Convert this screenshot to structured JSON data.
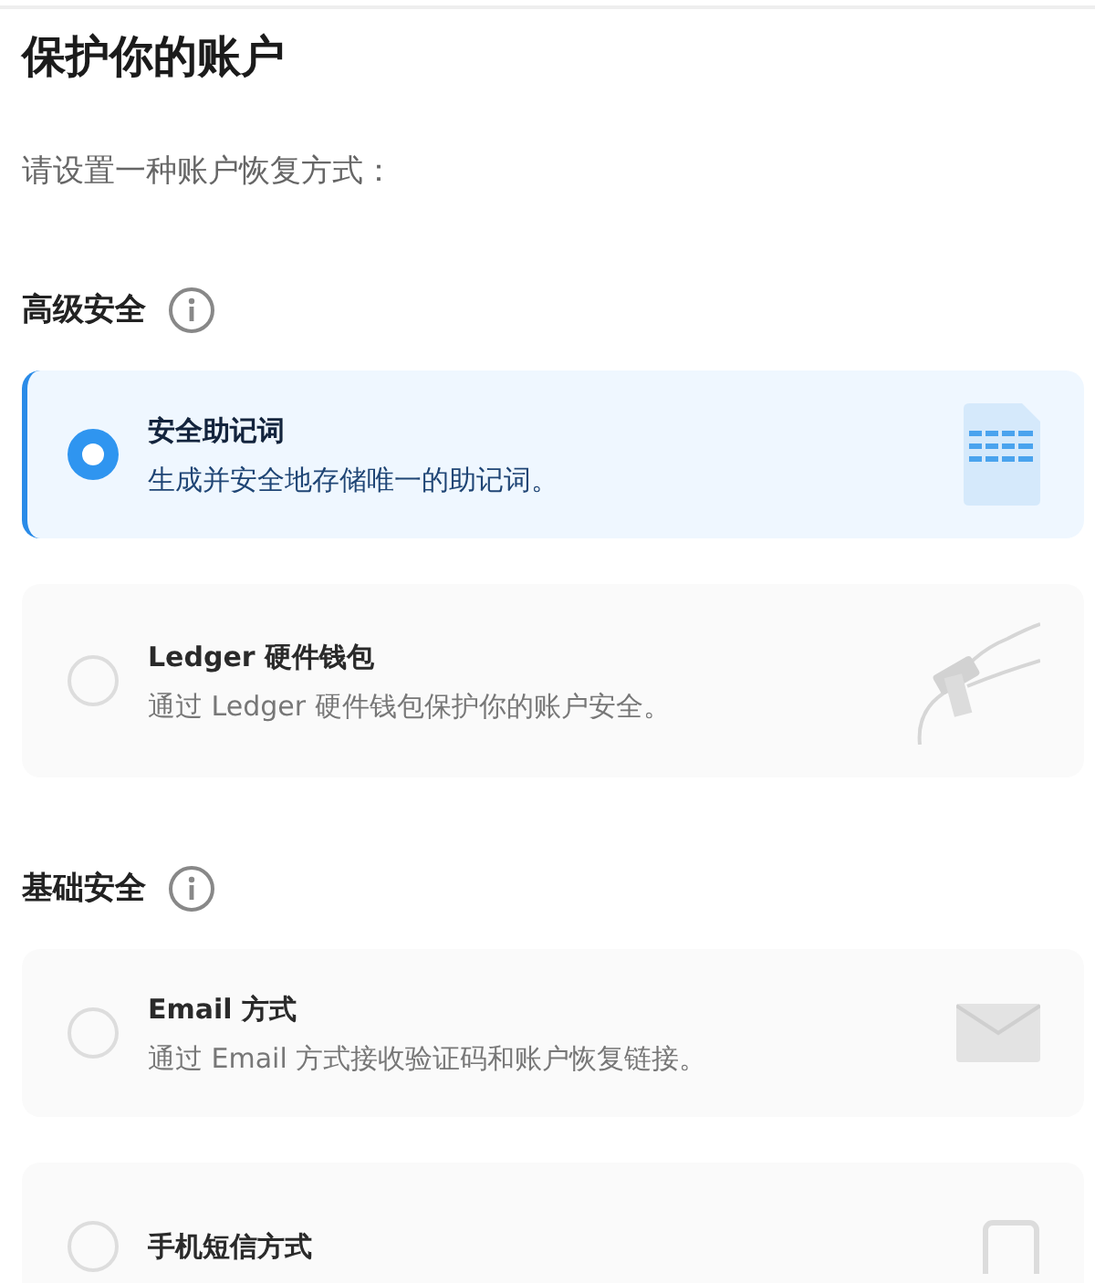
{
  "title": "保护你的账户",
  "subtitle": "请设置一种账户恢复方式：",
  "sections": [
    {
      "heading": "高级安全",
      "options": [
        {
          "kind": "document",
          "title": "安全助记词",
          "description": "生成并安全地存储唯一的助记词。",
          "selected": true
        },
        {
          "kind": "cable",
          "title": "Ledger 硬件钱包",
          "description": "通过 Ledger 硬件钱包保护你的账户安全。",
          "selected": false
        }
      ]
    },
    {
      "heading": "基础安全",
      "options": [
        {
          "kind": "envelope",
          "title": "Email 方式",
          "description": "通过 Email 方式接收验证码和账户恢复链接。",
          "selected": false
        },
        {
          "kind": "phone",
          "title": "手机短信方式",
          "selected": false
        }
      ]
    }
  ]
}
